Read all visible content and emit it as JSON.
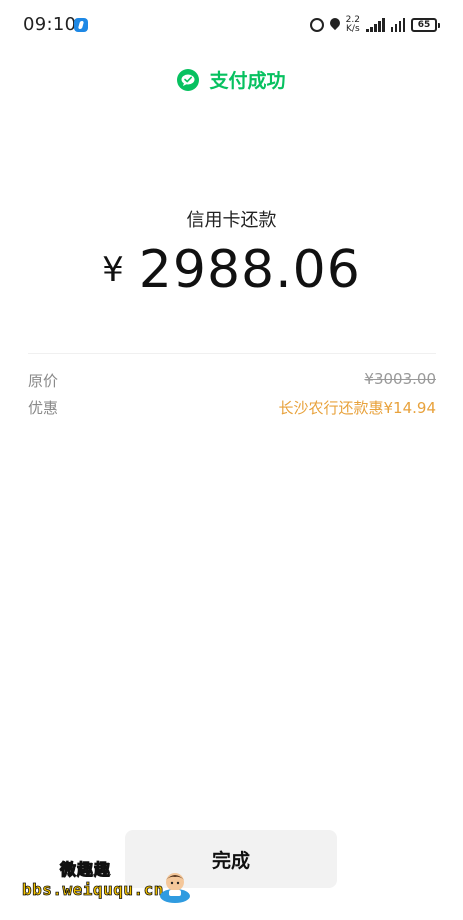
{
  "status_bar": {
    "time": "09:10",
    "net_speed_top": "2.2",
    "net_speed_bottom": "K/s",
    "battery": "65"
  },
  "header": {
    "success_text": "支付成功"
  },
  "payment": {
    "label": "信用卡还款",
    "currency": "¥",
    "amount": "2988.06"
  },
  "details": [
    {
      "key": "原价",
      "value": "¥3003.00"
    },
    {
      "key": "优惠",
      "value": "长沙农行还款惠¥14.94"
    }
  ],
  "actions": {
    "done_label": "完成"
  },
  "watermark": {
    "top": "微趣趣",
    "bottom": "bbs.weiququ.cn"
  },
  "colors": {
    "accent_green": "#07c160",
    "discount_orange": "#e8a23c"
  }
}
